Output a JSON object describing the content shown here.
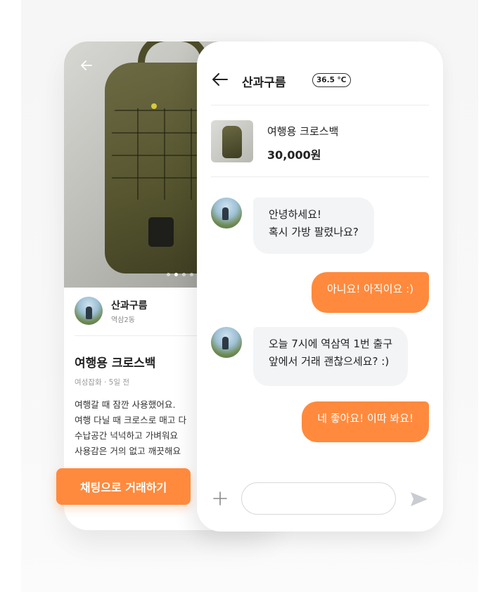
{
  "colors": {
    "accent": "#ff8a3d",
    "incoming_bubble": "#f2f4f6"
  },
  "product_card": {
    "icons": {
      "back": "arrow-left-icon"
    },
    "seller": {
      "name": "산과구름",
      "location": "역삼2동"
    },
    "title": "여행용 크로스백",
    "meta": "여성잡화 · 5일 전",
    "description": [
      "여행갈 때 잠깐 사용했어요.",
      "여행 다닐 때 크로스로 매고 다",
      "수납공간 넉넉하고 가벼워요",
      "사용감은 거의 없고 깨끗해요"
    ],
    "cta_label": "채팅으로 거래하기"
  },
  "chat": {
    "partner_name": "산과구름",
    "manner_temperature": "36.5 °C",
    "product": {
      "name": "여행용 크로스백",
      "price": "30,000원"
    },
    "messages": [
      {
        "from": "partner",
        "lines": [
          "안녕하세요!",
          "혹시 가방 팔렸나요?"
        ]
      },
      {
        "from": "me",
        "lines": [
          "아니요! 아직이요 :)"
        ]
      },
      {
        "from": "partner",
        "lines": [
          "오늘 7시에 역삼역 1번 출구",
          "앞에서 거래 괜찮으세요? :)"
        ]
      },
      {
        "from": "me",
        "lines": [
          "네 좋아요! 이따 봐요!"
        ]
      }
    ],
    "composer": {
      "placeholder": ""
    },
    "icons": {
      "back": "arrow-left-icon",
      "attach": "plus-icon",
      "send": "send-icon"
    }
  }
}
